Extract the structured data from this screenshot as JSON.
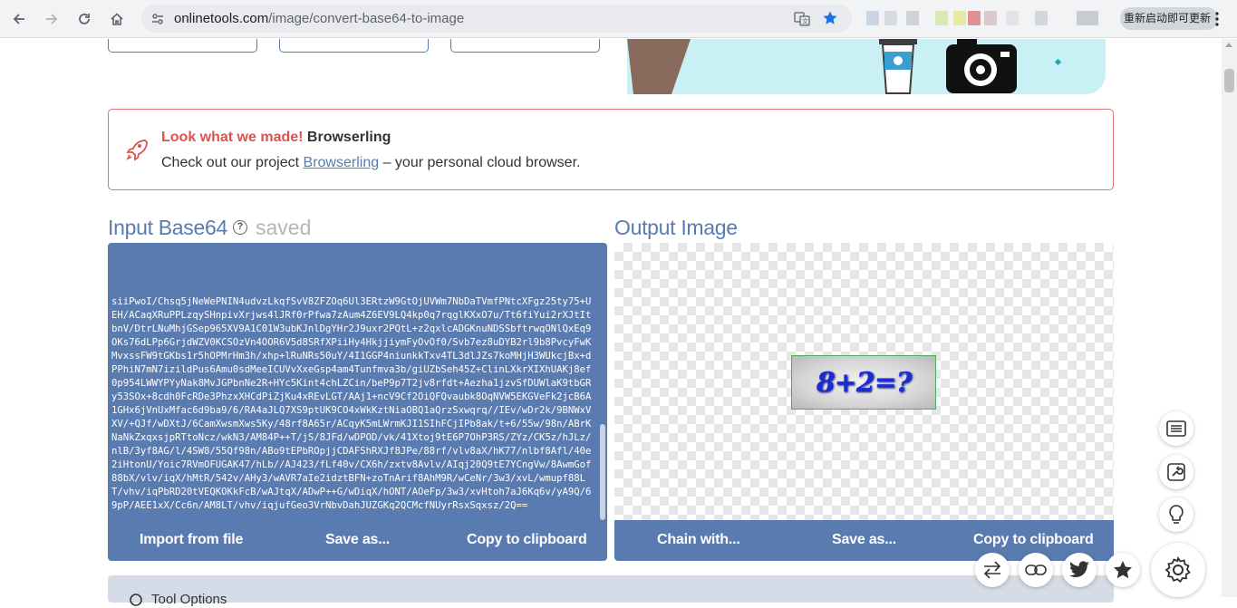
{
  "browser": {
    "url_host": "onlinetools.com",
    "url_path": "/image/convert-base64-to-image",
    "update_label": "重新启动即可更新"
  },
  "banner": {
    "highlight": "Look what we made!",
    "product": "Browserling",
    "text_before": "Check out our project ",
    "link": "Browserling",
    "text_after": " – your personal cloud browser."
  },
  "input": {
    "title": "Input Base64",
    "help": "?",
    "status": "saved",
    "value": "siiPwoI/Chsq5jNeWePNIN4udvzLkqfSvV8ZFZOq6Ul3ERtzW9GtOjUVWm7NbDaTVmfPNtcXFgz25ty75+UEH/ACaqXRuPPLzqySHnpivXrjws4lJRf0rPfwa7zAum4Z6EV9LQ4kp0q7rqglKXxO7u/Tt6fiYui2rXJtItbnV/DtrLNuMhjGSep965XV9A1C01W3ubKJnlDgYHr2J9uxr2PQtL+z2qxlcADGKnuNDSSbftrwqONlQxEq9OKs76dLPp6GrjdWZV0KCSOzVn4OOR6V5d8SRfXPiiHy4HkjjiymFyOvOf0/Svb7ez8uDYB2rl9b8PvcyFwKMvxssFW9tGKbs1r5hOPMrHm3h/xhp+lRuNRs50uY/4I1GGP4niunkkTxv4TL3dlJZs7koMHjH3WUkcjBx+dPPhiN7mN7izildPus6Amu0sdMeeICUVvXxeGsp4am4Tunfmva3b/giUZbSeh45Z+ClinLXkrXIXhUAKj8ef0p954LWWYPYyNak8MvJGPbnNe2R+HYc5Kint4chLZCin/beP9p7T2jv8rfdt+Aezha1jzvSfDUWlaK9tbGRy53SOx+8cdh0FcRDe3PhzxXHCdPiZjKu4xREvLGT/AAj1+ncV9Cf2OiQFQvaubk8OqNVW5EKGVeFk2jcB6A1GHx6jVnUxMfac6d9ba9/6/RA4aJLQ7XS9ptUK9CO4xWkKztNiaOBQ1aQrzSxwqrq//IEv/wDr2k/9BNWxVXV/+QJf/wDXtJ/6CamXwsmXws5Ky/48rf8A65r/ACqyK5mLWrmKJI1SIhFCjIPb8ak/t+6/55w/98n/ABrKNaNkZxqxsjpRTtoNcz/wkN3/AM84P++T/jS/8JFd/wDPOD/vk/41Xtoj9tE6P7OhP3RS/ZYz/CK5z/hJLz/nlB/3yf8AG/l/4SW8/55Qf98n/ABo9tEPbROpjjCDAFShRXJf8JPe/88rf/vlv8aX/hK77/nlbf8Afl/40e2iHtonU/Yoic7RVmOFUGAK47/hLb//AJ423/fLf40v/CX6h/zxtv8Avlv/AIqj20Q9tE7YCngVw/8AwmGof88bX/vlv/iqX/hMtR/542v/AHy3/wAVR7aIe2idztBFN+zoTnArif8AhM9R/wCeNr/3w3/xvL/wmupf88LT/vhv/iqPbRD20tVEQKOKkFcB/wAJtqX/ADwP++G/wDiqX/hONT/AOeFp/3w3/xvHtoh7aJ6Kq6v/yA9Q/69pP/AEE1xX/Cc6n/AM8LT/vhv/iqjufGeo3VrNbvDahJUZGKq2QCMcfNUyrRsxSqxsz/2Q=="
  },
  "output": {
    "title": "Output Image",
    "captcha_text": "8+2=?"
  },
  "input_buttons": {
    "import": "Import from file",
    "save": "Save as...",
    "copy": "Copy to clipboard"
  },
  "output_buttons": {
    "chain": "Chain with...",
    "save": "Save as...",
    "copy": "Copy to clipboard"
  },
  "tool_options": {
    "label": "Tool Options"
  }
}
